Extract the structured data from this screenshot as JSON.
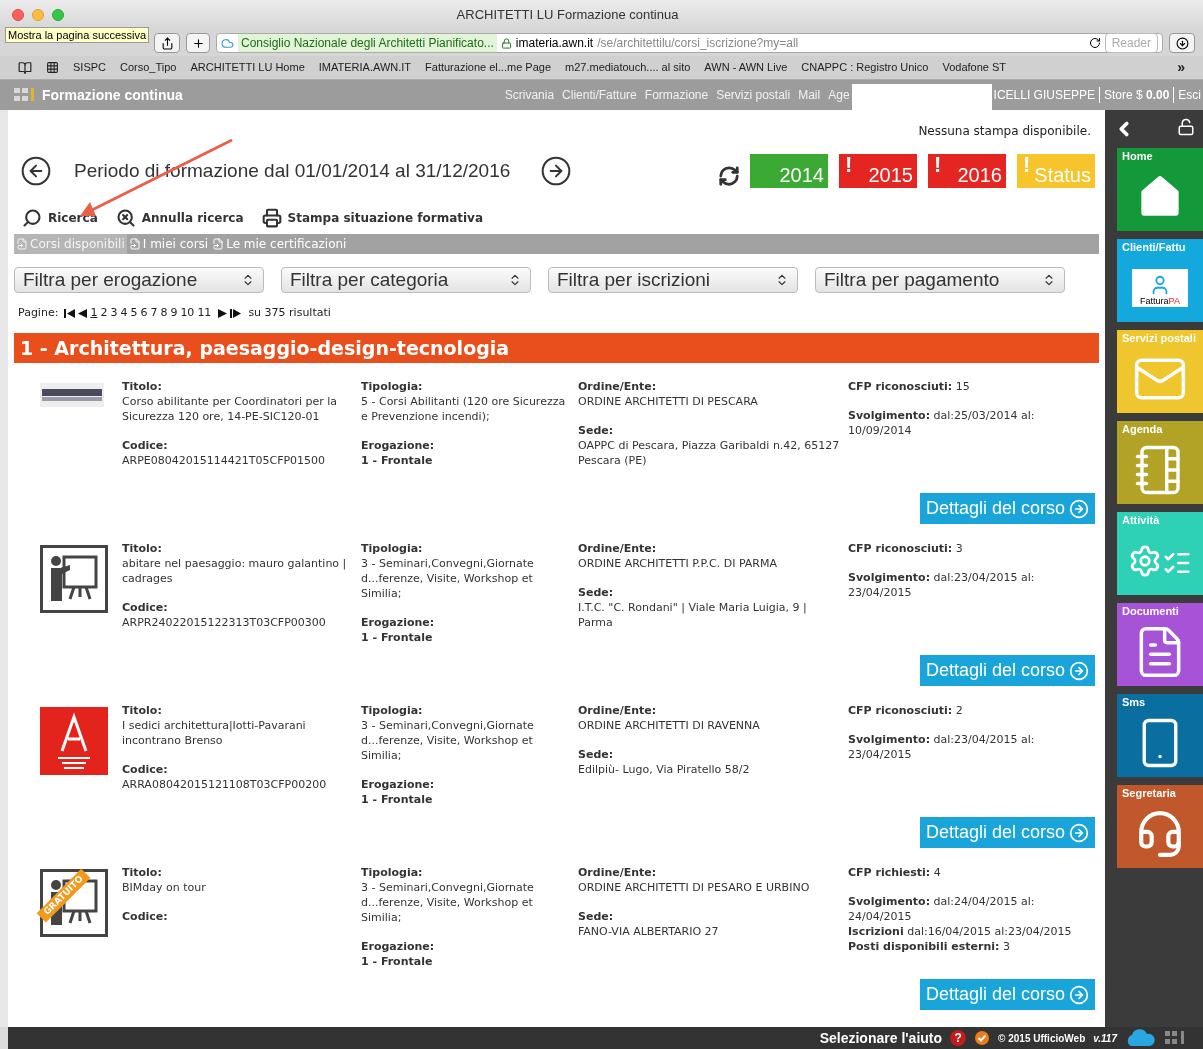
{
  "window": {
    "title": "ARCHITETTI LU Formazione continua"
  },
  "tooltip": "Mostra la pagina successiva",
  "address": {
    "site_badge": "Consiglio Nazionale degli Architetti Pianificato...",
    "host": "imateria.awn.it",
    "path": "/se/architettilu/corsi_iscrizione?my=all",
    "reader": "Reader"
  },
  "bookmarks": [
    "SISPC",
    "Corso_Tipo",
    "ARCHITETTI LU Home",
    "IMATERIA.AWN.IT",
    "Fatturazione el...me Page",
    "m27.mediatouch.... al sito",
    "AWN - AWN Live",
    "CNAPPC : Registro Unico",
    "Vodafone ST"
  ],
  "bookmarks_more": "»",
  "app_header": {
    "title": "Formazione continua",
    "nav": [
      "Scrivania",
      "Clienti/Fatture",
      "Formazione",
      "Servizi postali",
      "Mail",
      "Age"
    ],
    "user": "ICELLI GIUSEPPE",
    "store": "Store $ **0.00**",
    "logout": "Esci"
  },
  "no_print": "Nessuna stampa disponibile.",
  "period": "Periodo di formazione dal 01/01/2014 al 31/12/2016",
  "years": [
    {
      "label": "2014",
      "color": "#3aaa35"
    },
    {
      "label": "2015",
      "color": "#e52521",
      "mark": "!"
    },
    {
      "label": "2016",
      "color": "#e52521",
      "mark": "!"
    },
    {
      "label": "Status",
      "color": "#f7c52b",
      "mark": "!"
    }
  ],
  "actions": [
    {
      "kind": "search",
      "label": "Ricerca"
    },
    {
      "kind": "clear",
      "label": "Annulla ricerca"
    },
    {
      "kind": "print",
      "label": "Stampa situazione formativa"
    }
  ],
  "tabs": [
    {
      "label": "Corsi disponibili",
      "selected": true
    },
    {
      "label": "I miei corsi",
      "selected": false
    },
    {
      "label": "Le mie certificazioni",
      "selected": false
    }
  ],
  "filters": [
    "Filtra per erogazione",
    "Filtra per categoria",
    "Filtra per iscrizioni",
    "Filtra per pagamento"
  ],
  "pagination": {
    "label": "Pagine:",
    "pages": [
      {
        "label": "1",
        "selected": true
      },
      {
        "label": "2",
        "selected": false
      },
      {
        "label": "3",
        "selected": false
      },
      {
        "label": "4",
        "selected": false
      },
      {
        "label": "5",
        "selected": false
      },
      {
        "label": "6",
        "selected": false
      },
      {
        "label": "7",
        "selected": false
      },
      {
        "label": "8",
        "selected": false
      },
      {
        "label": "9",
        "selected": false
      },
      {
        "label": "10",
        "selected": false
      },
      {
        "label": "11",
        "selected": false
      }
    ],
    "results": "su 375 risultati"
  },
  "section": "1 - Architettura, paesaggio-design-tecnologia",
  "courses": [
    {
      "kind": "banner",
      "titolo": {
        "label": "Titolo:",
        "value": "Corso abilitante per Coordinatori per la Sicurezza 120 ore, 14-PE-SIC120-01"
      },
      "codice": {
        "label": "Codice:",
        "value": "ARPE08042015114421T05CFP01500"
      },
      "tipologia": {
        "label": "Tipologia:",
        "value": "5 - Corsi Abilitanti (120 ore Sicurezza e Prevenzione incendi);"
      },
      "erogazione": {
        "label": "Erogazione:",
        "value": "1 - Frontale"
      },
      "ordine": {
        "label": "Ordine/Ente:",
        "value": "ORDINE ARCHITETTI DI PESCARA"
      },
      "sede": {
        "label": "Sede:",
        "value": "OAPPC di Pescara, Piazza Garibaldi n.42, 65127 Pescara (PE)"
      },
      "cfp": "**CFP riconosciuti:** 15",
      "details": [
        "**Svolgimento:** dal:25/03/2014 al: 10/09/2014"
      ],
      "button": "Dettagli del corso"
    },
    {
      "kind": "presenter",
      "titolo": {
        "label": "Titolo:",
        "value": "abitare nel paesaggio: mauro galantino | cadrages"
      },
      "codice": {
        "label": "Codice:",
        "value": "ARPR24022015122313T03CFP00300"
      },
      "tipologia": {
        "label": "Tipologia:",
        "value": "3 - Seminari,Convegni,Giornate d...ferenze, Visite, Workshop et Similia;"
      },
      "erogazione": {
        "label": "Erogazione:",
        "value": "1 - Frontale"
      },
      "ordine": {
        "label": "Ordine/Ente:",
        "value": "ORDINE ARCHITETTI P.P.C. DI PARMA"
      },
      "sede": {
        "label": "Sede:",
        "value": "I.T.C. \"C. Rondani\" | Viale Maria Luigia, 9 | Parma"
      },
      "cfp": "**CFP riconosciuti:** 3",
      "details": [
        "**Svolgimento:** dal:23/04/2015 al: 23/04/2015"
      ],
      "button": "Dettagli del corso"
    },
    {
      "kind": "emblem",
      "titolo": {
        "label": "Titolo:",
        "value": "I sedici architettura|Iotti-Pavarani incontrano Brenso"
      },
      "codice": {
        "label": "Codice:",
        "value": "ARRA08042015121108T03CFP00200"
      },
      "tipologia": {
        "label": "Tipologia:",
        "value": "3 - Seminari,Convegni,Giornate d...ferenze, Visite, Workshop et Similia;"
      },
      "erogazione": {
        "label": "Erogazione:",
        "value": "1 - Frontale"
      },
      "ordine": {
        "label": "Ordine/Ente:",
        "value": "ORDINE ARCHITETTI DI RAVENNA"
      },
      "sede": {
        "label": "Sede:",
        "value": "Edilpiù- Lugo, Via Piratello 58/2"
      },
      "cfp": "**CFP riconosciuti:** 2",
      "details": [
        "**Svolgimento:** dal:23/04/2015 al: 23/04/2015"
      ],
      "button": "Dettagli del corso"
    },
    {
      "kind": "presenter",
      "ribbon": "GRATUITO",
      "titolo": {
        "label": "Titolo:",
        "value": "BIMday on tour"
      },
      "codice": {
        "label": "Codice:"
      },
      "tipologia": {
        "label": "Tipologia:",
        "value": "3 - Seminari,Convegni,Giornate d...ferenze, Visite, Workshop et Similia;"
      },
      "erogazione": {
        "label": "Erogazione:",
        "value": "1 - Frontale"
      },
      "ordine": {
        "label": "Ordine/Ente:",
        "value": "ORDINE ARCHITETTI DI PESARO E URBINO"
      },
      "sede": {
        "label": "Sede:",
        "value": "FANO-VIA ALBERTARIO 27"
      },
      "cfp": "**CFP richiesti:** 4",
      "details": [
        "**Svolgimento:** dal:24/04/2015 al: 24/04/2015",
        "**Iscrizioni** dal:16/04/2015 al:23/04/2015",
        "**Posti disponibili esterni:** 3"
      ],
      "button": "Dettagli del corso"
    }
  ],
  "sidebar": [
    {
      "kind": "home",
      "label": "Home",
      "color": "#13993a"
    },
    {
      "kind": "invoice",
      "label": "Clienti/Fattu",
      "color": "#14a9dc",
      "caption": "Fattura",
      "caption_accent": "PA"
    },
    {
      "kind": "mail",
      "label": "Servizi postali",
      "color": "#efc62e"
    },
    {
      "kind": "agenda",
      "label": "Agenda",
      "color": "#b2a327"
    },
    {
      "kind": "activity",
      "label": "Attività",
      "color": "#2ed0b6"
    },
    {
      "kind": "document",
      "label": "Documenti",
      "color": "#a653d8"
    },
    {
      "kind": "sms",
      "label": "Sms",
      "color": "#0b6ea1"
    },
    {
      "kind": "support",
      "label": "Segretaria",
      "color": "#c1582b"
    }
  ],
  "footer": {
    "help": "Selezionare l'aiuto",
    "help_mark": "?",
    "copyright": "© 2015 UfficioWeb",
    "version": "v.117"
  }
}
